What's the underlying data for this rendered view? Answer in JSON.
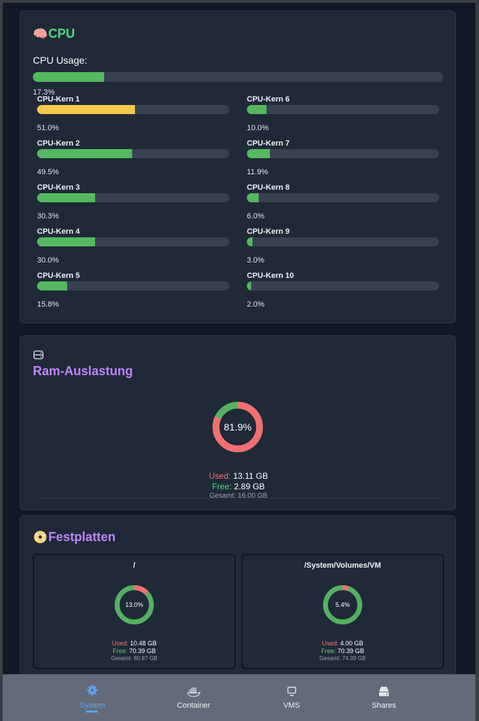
{
  "cpu": {
    "title_emoji": "🧠",
    "title": "CPU",
    "usage_label": "CPU Usage:",
    "usage_value": "17.3%",
    "usage_fraction": 0.173,
    "cores": [
      {
        "name": "CPU-Kern 1",
        "value": "51.0%",
        "fraction": 0.51,
        "color": "#f5c94a"
      },
      {
        "name": "CPU-Kern 2",
        "value": "49.5%",
        "fraction": 0.495,
        "color": "#55b860"
      },
      {
        "name": "CPU-Kern 3",
        "value": "30.3%",
        "fraction": 0.303,
        "color": "#55b860"
      },
      {
        "name": "CPU-Kern 4",
        "value": "30.0%",
        "fraction": 0.3,
        "color": "#55b860"
      },
      {
        "name": "CPU-Kern 5",
        "value": "15.8%",
        "fraction": 0.158,
        "color": "#55b860"
      },
      {
        "name": "CPU-Kern 6",
        "value": "10.0%",
        "fraction": 0.1,
        "color": "#55b860"
      },
      {
        "name": "CPU-Kern 7",
        "value": "11.9%",
        "fraction": 0.119,
        "color": "#55b860"
      },
      {
        "name": "CPU-Kern 8",
        "value": "6.0%",
        "fraction": 0.06,
        "color": "#55b860"
      },
      {
        "name": "CPU-Kern 9",
        "value": "3.0%",
        "fraction": 0.03,
        "color": "#55b860"
      },
      {
        "name": "CPU-Kern 10",
        "value": "2.0%",
        "fraction": 0.02,
        "color": "#55b860"
      }
    ]
  },
  "ram": {
    "icon": "hard-drive-icon",
    "title": "Ram-Auslastung",
    "percent_label": "81.9%",
    "used_fraction": 0.819,
    "used_label": "Used:",
    "used_value": "13.11 GB",
    "free_label": "Free:",
    "free_value": "2.89 GB",
    "total_label": "Gesamt:",
    "total_value": "16.00 GB"
  },
  "disks": {
    "title_emoji": "📀",
    "title": "Festplatten",
    "items": [
      {
        "name": "/",
        "percent_label": "13.0%",
        "used_fraction": 0.13,
        "used_label": "Used:",
        "used_value": "10.48 GB",
        "free_label": "Free:",
        "free_value": "70.39 GB",
        "total_label": "Gesamt:",
        "total_value": "80.87 GB"
      },
      {
        "name": "/System/Volumes/VM",
        "percent_label": "5.4%",
        "used_fraction": 0.054,
        "used_label": "Used:",
        "used_value": "4.00 GB",
        "free_label": "Free:",
        "free_value": "70.39 GB",
        "total_label": "Gesamt:",
        "total_value": "74.39 GB"
      }
    ]
  },
  "colors": {
    "used": "#f07070",
    "free": "#55b060",
    "track": "#374151",
    "accent": "#60a5fa"
  },
  "nav": {
    "items": [
      {
        "label": "System",
        "icon": "gear-icon",
        "active": true
      },
      {
        "label": "Container",
        "icon": "docker-icon",
        "active": false
      },
      {
        "label": "VMS",
        "icon": "monitor-icon",
        "active": false
      },
      {
        "label": "Shares",
        "icon": "server-icon",
        "active": false
      }
    ]
  }
}
